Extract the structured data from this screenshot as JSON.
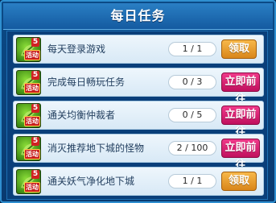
{
  "window": {
    "title": "每日任务"
  },
  "tasks": [
    {
      "name": "每天登录游戏",
      "progress": "1 / 1",
      "action": "领取",
      "action_type": "claim",
      "icon": "task-reward-icon",
      "level": "5",
      "badge": "活动"
    },
    {
      "name": "完成每日畅玩任务",
      "progress": "0 / 3",
      "action": "立即前往",
      "action_type": "go",
      "icon": "task-reward-icon",
      "level": "5",
      "badge": "活动"
    },
    {
      "name": "通关均衡仲裁者",
      "progress": "0 / 5",
      "action": "立即前往",
      "action_type": "go",
      "icon": "task-reward-icon",
      "level": "5",
      "badge": "活动"
    },
    {
      "name": "消灭推荐地下城的怪物",
      "progress": "2 / 100",
      "action": "立即前往",
      "action_type": "go",
      "icon": "task-reward-icon",
      "level": "5",
      "badge": "活动"
    },
    {
      "name": "通关妖气净化地下城",
      "progress": "1 / 1",
      "action": "领取",
      "action_type": "claim",
      "icon": "task-reward-icon",
      "level": "5",
      "badge": "活动"
    }
  ],
  "colors": {
    "claim_button": "#e39a2a",
    "go_button": "#d81e72",
    "panel_bg": "#0b4a86",
    "row_bg": "#e6f1fa"
  }
}
